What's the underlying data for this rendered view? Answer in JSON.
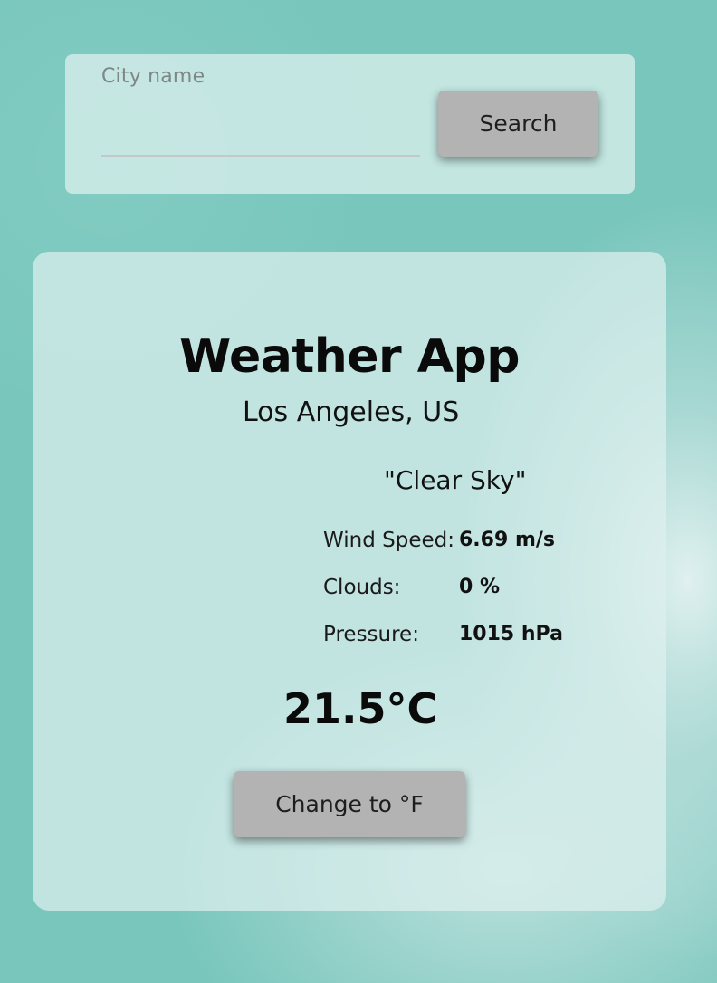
{
  "search": {
    "label": "City name",
    "value": "",
    "button_label": "Search"
  },
  "weather": {
    "title": "Weather App",
    "location": "Los Angeles, US",
    "description": "\"Clear Sky\"",
    "stats": [
      {
        "label": "Wind Speed:",
        "value": "6.69 m/s"
      },
      {
        "label": "Clouds:",
        "value": "0 %"
      },
      {
        "label": "Pressure:",
        "value": "1015 hPa"
      }
    ],
    "temperature": "21.5°C",
    "toggle_label": "Change to °F"
  },
  "colors": {
    "background": "#78c6bc",
    "button": "#b3b3b3",
    "panel": "#d8eeec"
  }
}
